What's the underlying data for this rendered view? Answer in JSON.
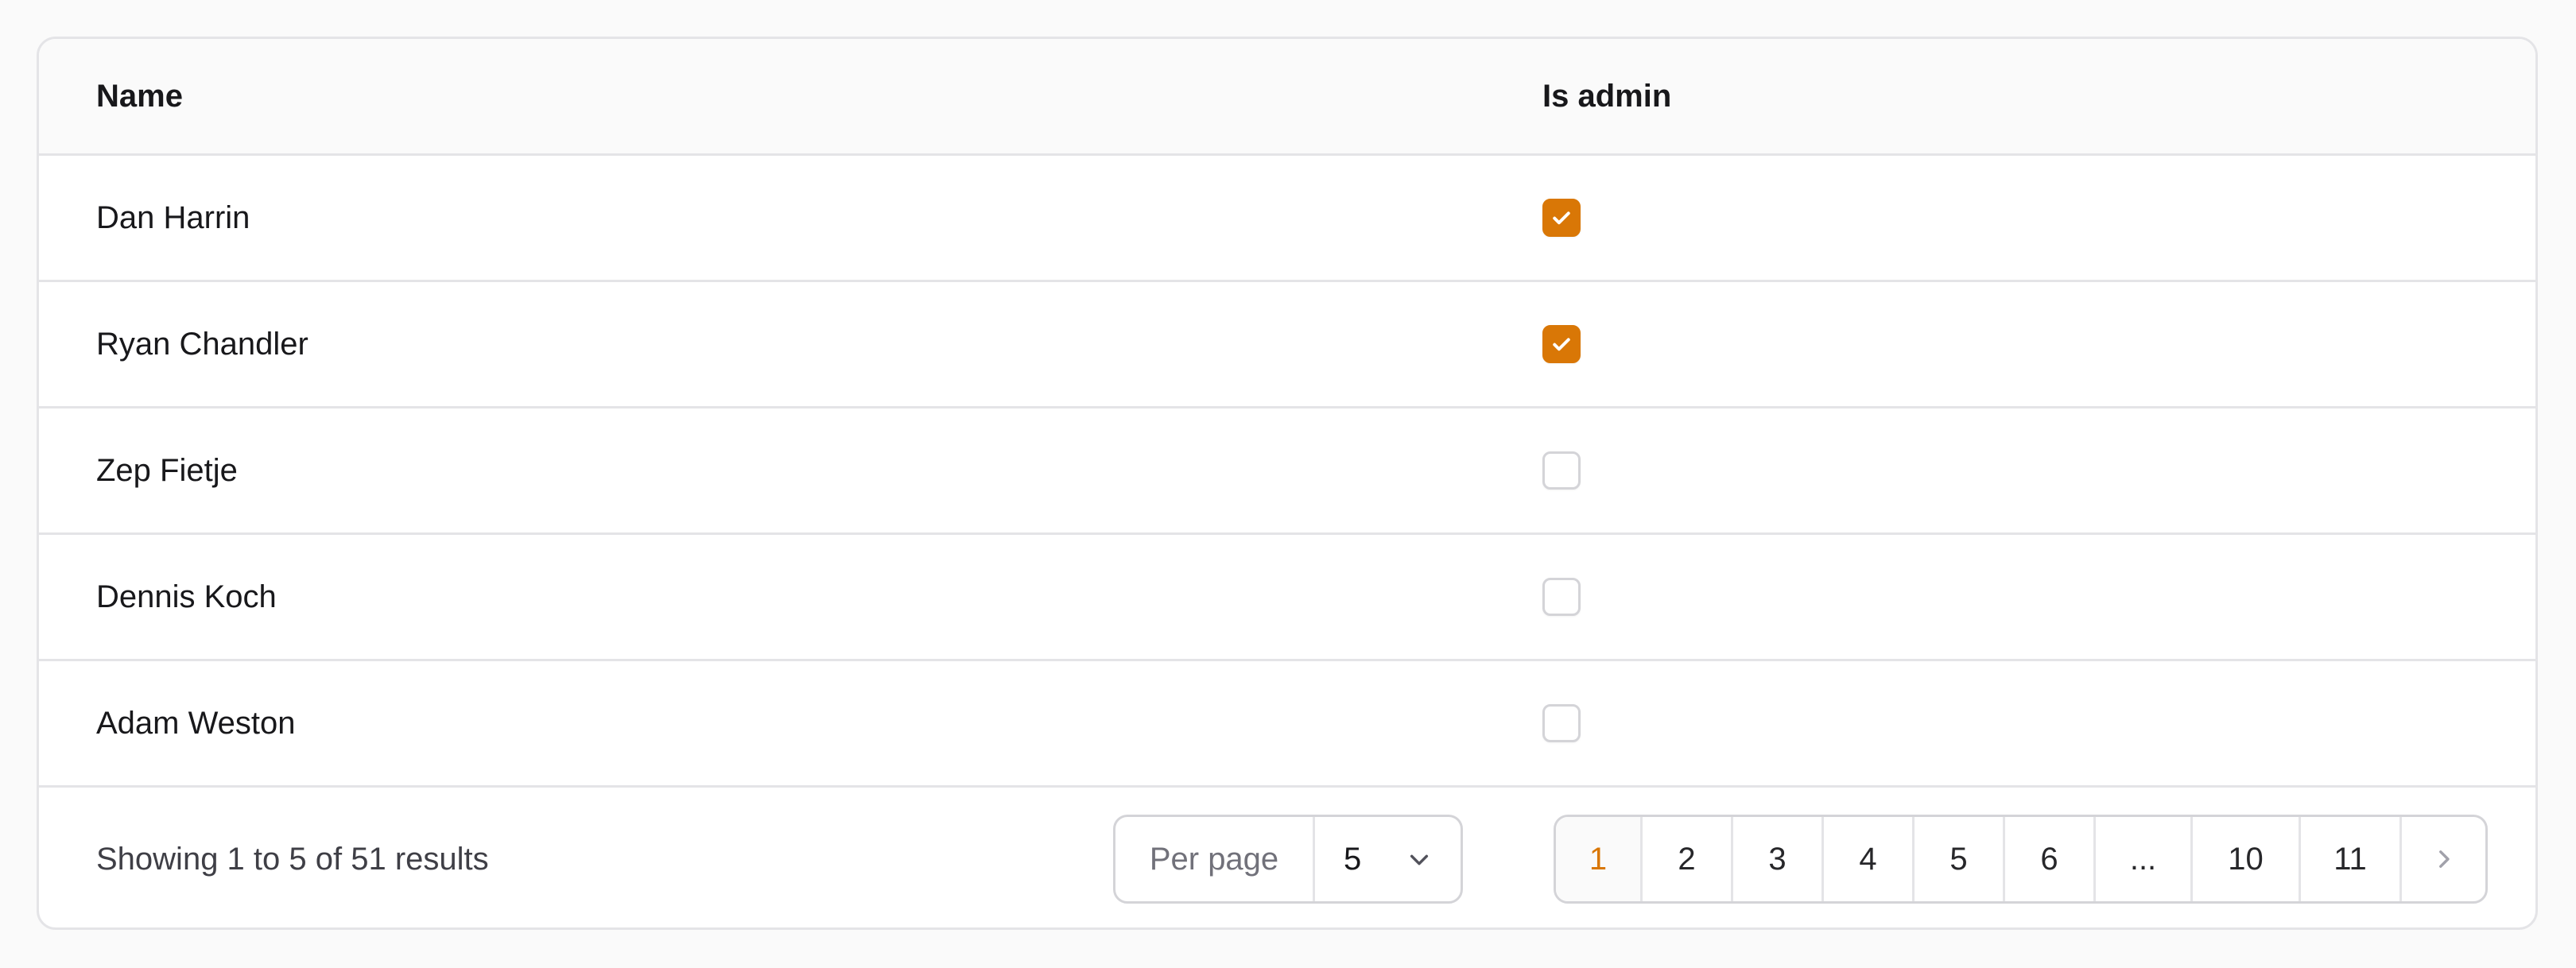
{
  "table": {
    "columns": {
      "name": "Name",
      "is_admin": "Is admin"
    },
    "rows": [
      {
        "name": "Dan Harrin",
        "is_admin": true
      },
      {
        "name": "Ryan Chandler",
        "is_admin": true
      },
      {
        "name": "Zep Fietje",
        "is_admin": false
      },
      {
        "name": "Dennis Koch",
        "is_admin": false
      },
      {
        "name": "Adam Weston",
        "is_admin": false
      }
    ]
  },
  "footer": {
    "showing_text": "Showing 1 to 5 of 51 results",
    "per_page_label": "Per page",
    "per_page_value": "5"
  },
  "pagination": {
    "pages": [
      "1",
      "2",
      "3",
      "4",
      "5",
      "6",
      "...",
      "10",
      "11"
    ],
    "current": "1",
    "next_icon": "chevron-right-icon"
  },
  "colors": {
    "accent": "#d97706",
    "border": "#e4e4e7",
    "header_bg": "#fafafa"
  }
}
